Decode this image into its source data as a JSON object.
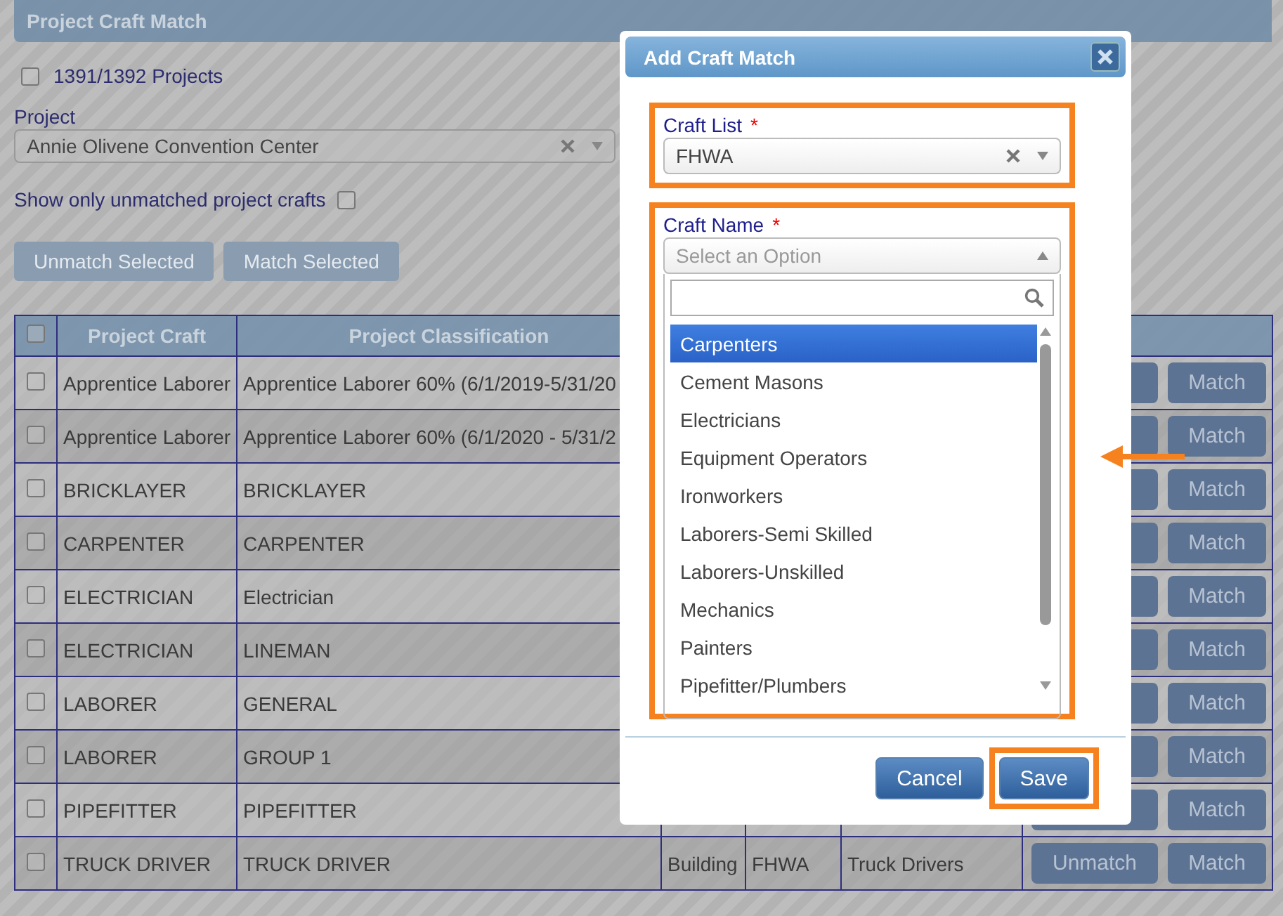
{
  "page": {
    "title": "Project Craft Match",
    "all_projects": {
      "label": "1391/1392 Projects",
      "checked": false
    },
    "project": {
      "label": "Project",
      "value": "Annie Olivene Convention Center"
    },
    "unmatched_only": {
      "label": "Show only unmatched project crafts",
      "checked": false
    },
    "buttons": [
      {
        "label": "Unmatch Selected",
        "disabled": true
      },
      {
        "label": "Match Selected",
        "disabled": true
      }
    ]
  },
  "table": {
    "select_all_checked": false,
    "columns": [
      "Project Craft",
      "Project Classification"
    ],
    "rows": [
      {
        "checked": false,
        "project_craft": "Apprentice Laborer",
        "classification": "Apprentice Laborer 60% (6/1/2019-5/31/20",
        "match": "Match"
      },
      {
        "checked": false,
        "project_craft": "Apprentice Laborer",
        "classification": "Apprentice Laborer 60% (6/1/2020 - 5/31/2",
        "match": "Match"
      },
      {
        "checked": false,
        "project_craft": "BRICKLAYER",
        "classification": "BRICKLAYER",
        "match": "Match"
      },
      {
        "checked": false,
        "project_craft": "CARPENTER",
        "classification": "CARPENTER",
        "match": "Match"
      },
      {
        "checked": false,
        "project_craft": "ELECTRICIAN",
        "classification": "Electrician",
        "match": "Match"
      },
      {
        "checked": false,
        "project_craft": "ELECTRICIAN",
        "classification": "LINEMAN",
        "match": "Match"
      },
      {
        "checked": false,
        "project_craft": "LABORER",
        "classification": "GENERAL",
        "match": "Match"
      },
      {
        "checked": false,
        "project_craft": "LABORER",
        "classification": "GROUP 1",
        "match": "Match"
      },
      {
        "checked": false,
        "project_craft": "PIPEFITTER",
        "classification": "PIPEFITTER",
        "match": "Match"
      },
      {
        "checked": false,
        "project_craft": "TRUCK DRIVER",
        "classification": "TRUCK DRIVER",
        "column_4": "Building",
        "column_5": "FHWA",
        "column_6": "Truck Drivers",
        "unmatch": "Unmatch",
        "match": "Match"
      }
    ]
  },
  "modal": {
    "title": "Add Craft Match",
    "craft_list": {
      "label": "Craft List",
      "required_mark": "*",
      "value": "FHWA"
    },
    "craft_name": {
      "label": "Craft Name",
      "required_mark": "*",
      "placeholder": "Select an Option",
      "expanded": true,
      "options": [
        {
          "label": "Carpenters",
          "selected": true
        },
        {
          "label": "Cement Masons",
          "selected": false
        },
        {
          "label": "Electricians",
          "selected": false
        },
        {
          "label": "Equipment Operators",
          "selected": false
        },
        {
          "label": "Ironworkers",
          "selected": false
        },
        {
          "label": "Laborers-Semi Skilled",
          "selected": false
        },
        {
          "label": "Laborers-Unskilled",
          "selected": false
        },
        {
          "label": "Mechanics",
          "selected": false
        },
        {
          "label": "Painters",
          "selected": false
        },
        {
          "label": "Pipefitter/Plumbers",
          "selected": false
        }
      ]
    },
    "buttons": [
      "Cancel",
      "Save"
    ]
  }
}
